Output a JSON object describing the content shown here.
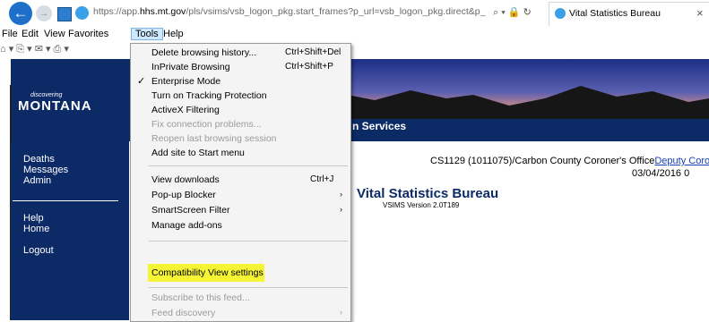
{
  "browser": {
    "url_prefix": "https://app.",
    "url_domain": "hhs.mt.gov",
    "url_rest": "/pls/vsims/vsb_logon_pkg.start_frames?p_url=vsb_logon_pkg.direct&p_logoff=",
    "address_tools": "⌕ ▾ 🔒 ↻",
    "tab_title": "Vital Statistics Bureau",
    "tab_close": "×"
  },
  "menubar": {
    "file": "File",
    "edit": "Edit",
    "view": "View",
    "favorites": "Favorites",
    "tools": "Tools",
    "help": "Help"
  },
  "cmdbar": {
    "text": "⌂ ▾ ⎘ ▾ ✉ ▾ ⎙ ▾"
  },
  "page": {
    "logo_small": "discovering",
    "logo": "MONTANA",
    "services": "n Services",
    "sidebar": {
      "deaths": "Deaths",
      "messages": "Messages",
      "admin": "Admin",
      "help": "Help",
      "home": "Home",
      "logout": "Logout"
    },
    "user_info": "CS1129 (1011075)/Carbon County Coroner's Office",
    "user_link": "Deputy Corone",
    "date": "03/04/2016 0",
    "bureau_title": "Vital Statistics Bureau",
    "version": "VSIMS Version 2.0T189"
  },
  "tools_menu": {
    "delete_history": "Delete browsing history...",
    "delete_history_shortcut": "Ctrl+Shift+Del",
    "inprivate": "InPrivate Browsing",
    "inprivate_shortcut": "Ctrl+Shift+P",
    "enterprise_mode": "Enterprise Mode",
    "check": "✓",
    "tracking": "Turn on Tracking Protection",
    "activex": "ActiveX Filtering",
    "fix_connection": "Fix connection problems...",
    "reopen": "Reopen last browsing session",
    "add_site": "Add site to Start menu",
    "view_downloads": "View downloads",
    "view_downloads_shortcut": "Ctrl+J",
    "popup_blocker": "Pop-up Blocker",
    "smartscreen": "SmartScreen Filter",
    "manage_addons": "Manage add-ons",
    "compat_view": "Compatibility View settings",
    "subscribe": "Subscribe to this feed...",
    "feed_discovery": "Feed discovery",
    "arrow": "›"
  }
}
